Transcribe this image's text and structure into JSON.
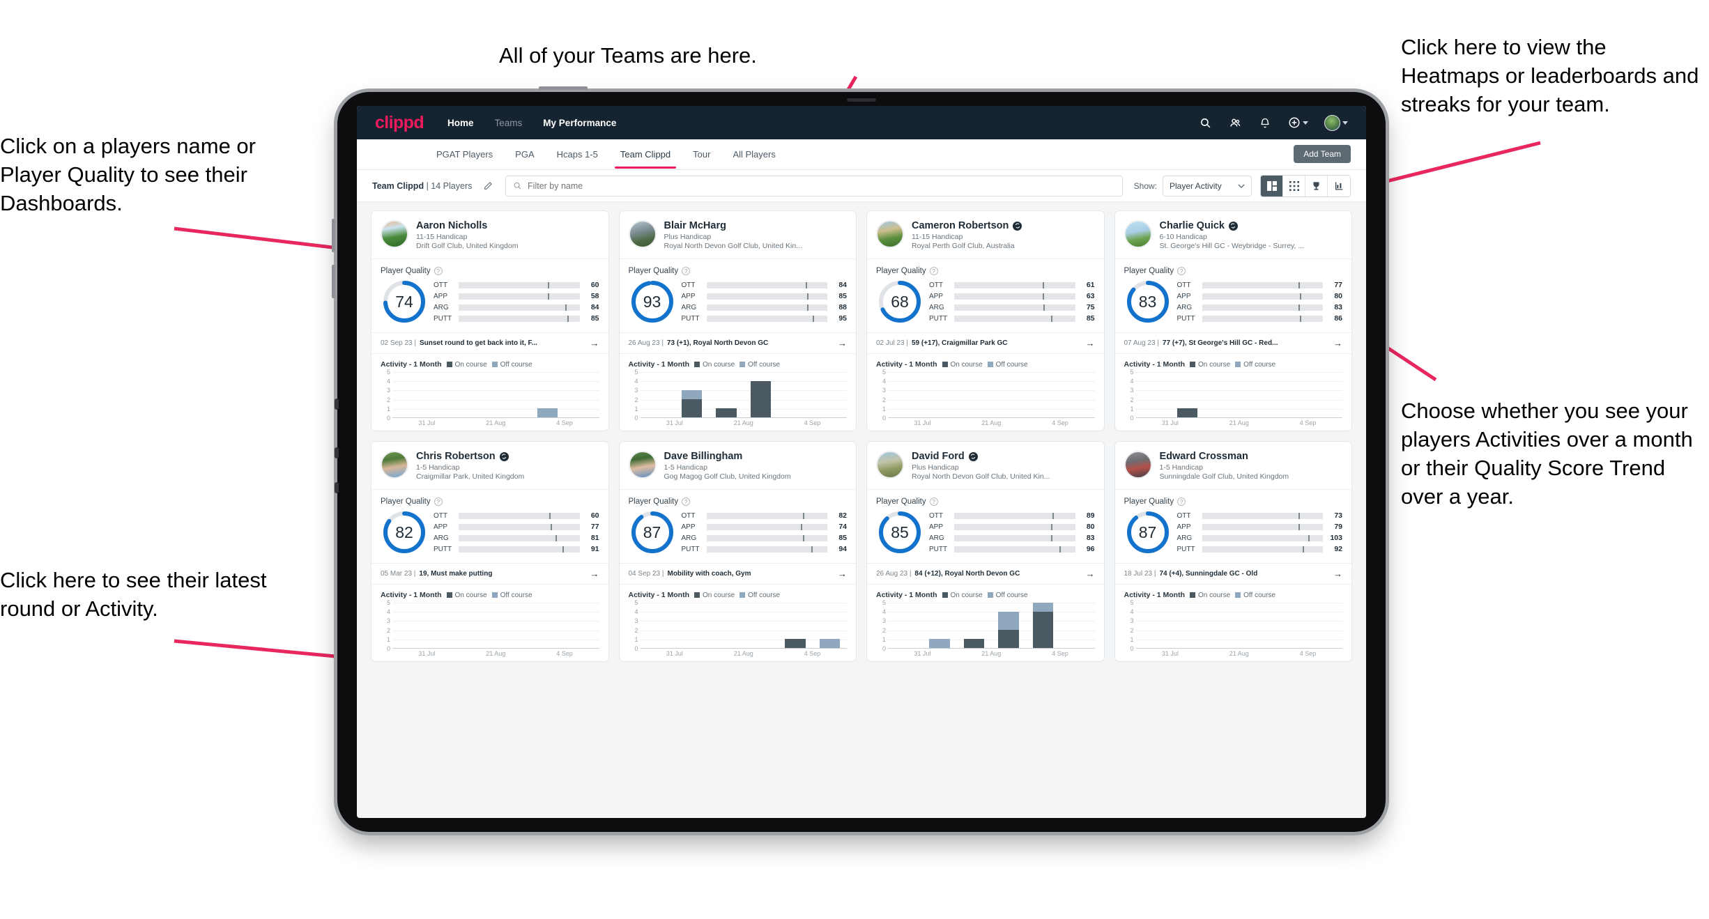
{
  "annotations": {
    "left_top": "Click on a players name or Player Quality to see their Dashboards.",
    "top_center": "All of your Teams are here.",
    "right_top": "Click here to view the Heatmaps or leaderboards and streaks for your team.",
    "right_mid": "Choose whether you see your players Activities over a month or their Quality Score Trend over a year.",
    "left_bottom": "Click here to see their latest round or Activity.",
    "arrow_color": "#e8275f"
  },
  "navbar": {
    "brand": "clippd",
    "links": [
      {
        "label": "Home",
        "state": "active"
      },
      {
        "label": "Teams",
        "state": "dim"
      },
      {
        "label": "My Performance",
        "state": "active"
      }
    ],
    "icons": [
      "search-icon",
      "people-icon",
      "bell-icon",
      "plus-circle-icon",
      "avatar"
    ]
  },
  "tabbar": {
    "tabs": [
      {
        "label": "PGAT Players",
        "active": false
      },
      {
        "label": "PGA",
        "active": false
      },
      {
        "label": "Hcaps 1-5",
        "active": false
      },
      {
        "label": "Team Clippd",
        "active": true
      },
      {
        "label": "Tour",
        "active": false
      },
      {
        "label": "All Players",
        "active": false
      }
    ],
    "add_team_label": "Add Team"
  },
  "toolbar": {
    "team_name": "Team Clippd",
    "player_count": "| 14 Players",
    "edit_icon": "pencil-icon",
    "search_placeholder": "Filter by name",
    "search_value": "",
    "show_label": "Show:",
    "select_value": "Player Activity",
    "view_buttons": [
      {
        "name": "grid-large-view",
        "active": true
      },
      {
        "name": "grid-small-view",
        "active": false
      },
      {
        "name": "trophy-leaderboard-view",
        "active": false
      },
      {
        "name": "heatmap-view",
        "active": false
      }
    ]
  },
  "card_labels": {
    "player_quality": "Player Quality",
    "activity_title": "Activity - 1 Month",
    "legend_on": "On course",
    "legend_off": "Off course",
    "metrics": [
      "OTT",
      "APP",
      "ARG",
      "PUTT"
    ],
    "y_ticks": [
      "5",
      "4",
      "3",
      "2",
      "1",
      "0"
    ],
    "x_ticks": [
      "31 Jul",
      "21 Aug",
      "4 Sep"
    ],
    "arrow": "→"
  },
  "colors": {
    "ott": "#f7b008",
    "app": "#3ddcb0",
    "arg": "#f5005e",
    "putt": "#a600cc",
    "ring": "#1372cc",
    "on_course": "#4a5962",
    "off_course": "#8fa8bd",
    "brand": "#ec1a5c"
  },
  "players": [
    {
      "name": "Aaron Nicholls",
      "verified": false,
      "handicap": "11-15 Handicap",
      "club": "Drift Golf Club, United Kingdom",
      "quality": 74,
      "ring_pct": 74,
      "avatar_css": "linear-gradient(170deg,#e8b48c 0%,#c9e3ee 28%,#4a8a3c 60%,#2f6b28 100%)",
      "metrics": [
        {
          "label": "OTT",
          "value": 60,
          "fill": 55,
          "tick": 74
        },
        {
          "label": "APP",
          "value": 58,
          "fill": 52,
          "tick": 74
        },
        {
          "label": "ARG",
          "value": 84,
          "fill": 78,
          "tick": 88
        },
        {
          "label": "PUTT",
          "value": 85,
          "fill": 80,
          "tick": 90
        }
      ],
      "latest_date": "02 Sep 23",
      "latest_text": "Sunset round to get back into it, F...",
      "chart": {
        "type": "bar",
        "categories": [
          "31 Jul",
          "21 Aug",
          "4 Sep"
        ],
        "ylim": [
          0,
          5
        ],
        "bars": [
          {
            "on": 0,
            "off": 0
          },
          {
            "on": 0,
            "off": 0
          },
          {
            "on": 0,
            "off": 0
          },
          {
            "on": 0,
            "off": 0
          },
          {
            "on": 0,
            "off": 1
          },
          {
            "on": 0,
            "off": 0
          }
        ]
      }
    },
    {
      "name": "Blair McHarg",
      "verified": false,
      "handicap": "Plus Handicap",
      "club": "Royal North Devon Golf Club, United Kin...",
      "quality": 93,
      "ring_pct": 97,
      "avatar_css": "linear-gradient(165deg,#b9c7cf 0%,#7d8c93 40%,#4d6b45 70%,#3b5633 100%)",
      "metrics": [
        {
          "label": "OTT",
          "value": 84,
          "fill": 72,
          "tick": 82
        },
        {
          "label": "APP",
          "value": 85,
          "fill": 73,
          "tick": 83
        },
        {
          "label": "ARG",
          "value": 88,
          "fill": 74,
          "tick": 83
        },
        {
          "label": "PUTT",
          "value": 95,
          "fill": 82,
          "tick": 88
        }
      ],
      "latest_date": "26 Aug 23",
      "latest_text": "73 (+1), Royal North Devon GC",
      "chart": {
        "type": "bar",
        "categories": [
          "31 Jul",
          "21 Aug",
          "4 Sep"
        ],
        "ylim": [
          0,
          5
        ],
        "bars": [
          {
            "on": 0,
            "off": 0
          },
          {
            "on": 2,
            "off": 1
          },
          {
            "on": 1,
            "off": 0
          },
          {
            "on": 4,
            "off": 0
          },
          {
            "on": 0,
            "off": 0
          },
          {
            "on": 0,
            "off": 0
          }
        ]
      }
    },
    {
      "name": "Cameron Robertson",
      "verified": true,
      "handicap": "11-15 Handicap",
      "club": "Royal Perth Golf Club, Australia",
      "quality": 68,
      "ring_pct": 68,
      "avatar_css": "linear-gradient(170deg,#9fc6de 0%,#cdbf8e 35%,#5b8f3e 65%,#3d6e2a 100%)",
      "metrics": [
        {
          "label": "OTT",
          "value": 61,
          "fill": 55,
          "tick": 73
        },
        {
          "label": "APP",
          "value": 63,
          "fill": 56,
          "tick": 73
        },
        {
          "label": "ARG",
          "value": 75,
          "fill": 65,
          "tick": 74
        },
        {
          "label": "PUTT",
          "value": 85,
          "fill": 72,
          "tick": 80
        }
      ],
      "latest_date": "02 Jul 23",
      "latest_text": "59 (+17), Craigmillar Park GC",
      "chart": {
        "type": "bar",
        "categories": [
          "31 Jul",
          "21 Aug",
          "4 Sep"
        ],
        "ylim": [
          0,
          5
        ],
        "bars": [
          {
            "on": 0,
            "off": 0
          },
          {
            "on": 0,
            "off": 0
          },
          {
            "on": 0,
            "off": 0
          },
          {
            "on": 0,
            "off": 0
          },
          {
            "on": 0,
            "off": 0
          },
          {
            "on": 0,
            "off": 0
          }
        ]
      }
    },
    {
      "name": "Charlie Quick",
      "verified": true,
      "handicap": "6-10 Handicap",
      "club": "St. George's Hill GC - Weybridge - Surrey, ...",
      "quality": 83,
      "ring_pct": 86,
      "avatar_css": "linear-gradient(170deg,#bfe0f2 0%,#a8cfe6 40%,#6ba34c 68%,#4a7f35 100%)",
      "metrics": [
        {
          "label": "OTT",
          "value": 77,
          "fill": 67,
          "tick": 80
        },
        {
          "label": "APP",
          "value": 80,
          "fill": 69,
          "tick": 81
        },
        {
          "label": "ARG",
          "value": 83,
          "fill": 70,
          "tick": 80
        },
        {
          "label": "PUTT",
          "value": 86,
          "fill": 73,
          "tick": 81
        }
      ],
      "latest_date": "07 Aug 23",
      "latest_text": "77 (+7), St George's Hill GC - Red...",
      "chart": {
        "type": "bar",
        "categories": [
          "31 Jul",
          "21 Aug",
          "4 Sep"
        ],
        "ylim": [
          0,
          5
        ],
        "bars": [
          {
            "on": 0,
            "off": 0
          },
          {
            "on": 1,
            "off": 0
          },
          {
            "on": 0,
            "off": 0
          },
          {
            "on": 0,
            "off": 0
          },
          {
            "on": 0,
            "off": 0
          },
          {
            "on": 0,
            "off": 0
          }
        ]
      }
    },
    {
      "name": "Chris Robertson",
      "verified": true,
      "handicap": "1-5 Handicap",
      "club": "Craigmillar Park, United Kingdom",
      "quality": 82,
      "ring_pct": 85,
      "avatar_css": "linear-gradient(170deg,#6f9a55 0%,#4f7a3a 30%,#d8b79a 58%,#6fa7d8 100%)",
      "metrics": [
        {
          "label": "OTT",
          "value": 60,
          "fill": 55,
          "tick": 75
        },
        {
          "label": "APP",
          "value": 77,
          "fill": 70,
          "tick": 76
        },
        {
          "label": "ARG",
          "value": 81,
          "fill": 74,
          "tick": 80
        },
        {
          "label": "PUTT",
          "value": 91,
          "fill": 80,
          "tick": 86
        }
      ],
      "latest_date": "05 Mar 23",
      "latest_text": "19, Must make putting",
      "chart": {
        "type": "bar",
        "categories": [
          "31 Jul",
          "21 Aug",
          "4 Sep"
        ],
        "ylim": [
          0,
          5
        ],
        "bars": [
          {
            "on": 0,
            "off": 0
          },
          {
            "on": 0,
            "off": 0
          },
          {
            "on": 0,
            "off": 0
          },
          {
            "on": 0,
            "off": 0
          },
          {
            "on": 0,
            "off": 0
          },
          {
            "on": 0,
            "off": 0
          }
        ]
      }
    },
    {
      "name": "Dave Billingham",
      "verified": false,
      "handicap": "1-5 Handicap",
      "club": "Gog Magog Golf Club, United Kingdom",
      "quality": 87,
      "ring_pct": 90,
      "avatar_css": "linear-gradient(170deg,#5d8a4a 0%,#3f6b33 28%,#e0bda2 58%,#5c8fc4 100%)",
      "metrics": [
        {
          "label": "OTT",
          "value": 82,
          "fill": 71,
          "tick": 80
        },
        {
          "label": "APP",
          "value": 74,
          "fill": 64,
          "tick": 78
        },
        {
          "label": "ARG",
          "value": 85,
          "fill": 73,
          "tick": 80
        },
        {
          "label": "PUTT",
          "value": 94,
          "fill": 82,
          "tick": 87
        }
      ],
      "latest_date": "04 Sep 23",
      "latest_text": "Mobility with coach, Gym",
      "chart": {
        "type": "bar",
        "categories": [
          "31 Jul",
          "21 Aug",
          "4 Sep"
        ],
        "ylim": [
          0,
          5
        ],
        "bars": [
          {
            "on": 0,
            "off": 0
          },
          {
            "on": 0,
            "off": 0
          },
          {
            "on": 0,
            "off": 0
          },
          {
            "on": 0,
            "off": 0
          },
          {
            "on": 1,
            "off": 0
          },
          {
            "on": 0,
            "off": 1
          }
        ]
      }
    },
    {
      "name": "David Ford",
      "verified": true,
      "handicap": "Plus Handicap",
      "club": "Royal North Devon Golf Club, United Kin...",
      "quality": 85,
      "ring_pct": 88,
      "avatar_css": "linear-gradient(170deg,#9ec6dd 0%,#c3c3a8 38%,#8f9a62 65%,#6d7a4a 100%)",
      "metrics": [
        {
          "label": "OTT",
          "value": 89,
          "fill": 77,
          "tick": 81
        },
        {
          "label": "APP",
          "value": 80,
          "fill": 69,
          "tick": 80
        },
        {
          "label": "ARG",
          "value": 83,
          "fill": 70,
          "tick": 80
        },
        {
          "label": "PUTT",
          "value": 96,
          "fill": 83,
          "tick": 87
        }
      ],
      "latest_date": "26 Aug 23",
      "latest_text": "84 (+12), Royal North Devon GC",
      "chart": {
        "type": "bar",
        "categories": [
          "31 Jul",
          "21 Aug",
          "4 Sep"
        ],
        "ylim": [
          0,
          5
        ],
        "bars": [
          {
            "on": 0,
            "off": 0
          },
          {
            "on": 0,
            "off": 1
          },
          {
            "on": 1,
            "off": 0
          },
          {
            "on": 2,
            "off": 2
          },
          {
            "on": 4,
            "off": 1
          },
          {
            "on": 0,
            "off": 0
          }
        ]
      }
    },
    {
      "name": "Edward Crossman",
      "verified": false,
      "handicap": "1-5 Handicap",
      "club": "Sunningdale Golf Club, United Kingdom",
      "quality": 87,
      "ring_pct": 89,
      "avatar_css": "linear-gradient(170deg,#8f8f94 0%,#6d6d72 35%,#b5504a 62%,#3e4048 100%)",
      "metrics": [
        {
          "label": "OTT",
          "value": 73,
          "fill": 63,
          "tick": 80
        },
        {
          "label": "APP",
          "value": 79,
          "fill": 68,
          "tick": 80
        },
        {
          "label": "ARG",
          "value": 103,
          "fill": 82,
          "tick": 88
        },
        {
          "label": "PUTT",
          "value": 92,
          "fill": 77,
          "tick": 83
        }
      ],
      "latest_date": "18 Jul 23",
      "latest_text": "74 (+4), Sunningdale GC - Old",
      "chart": {
        "type": "bar",
        "categories": [
          "31 Jul",
          "21 Aug",
          "4 Sep"
        ],
        "ylim": [
          0,
          5
        ],
        "bars": [
          {
            "on": 0,
            "off": 0
          },
          {
            "on": 0,
            "off": 0
          },
          {
            "on": 0,
            "off": 0
          },
          {
            "on": 0,
            "off": 0
          },
          {
            "on": 0,
            "off": 0
          },
          {
            "on": 0,
            "off": 0
          }
        ]
      }
    }
  ]
}
